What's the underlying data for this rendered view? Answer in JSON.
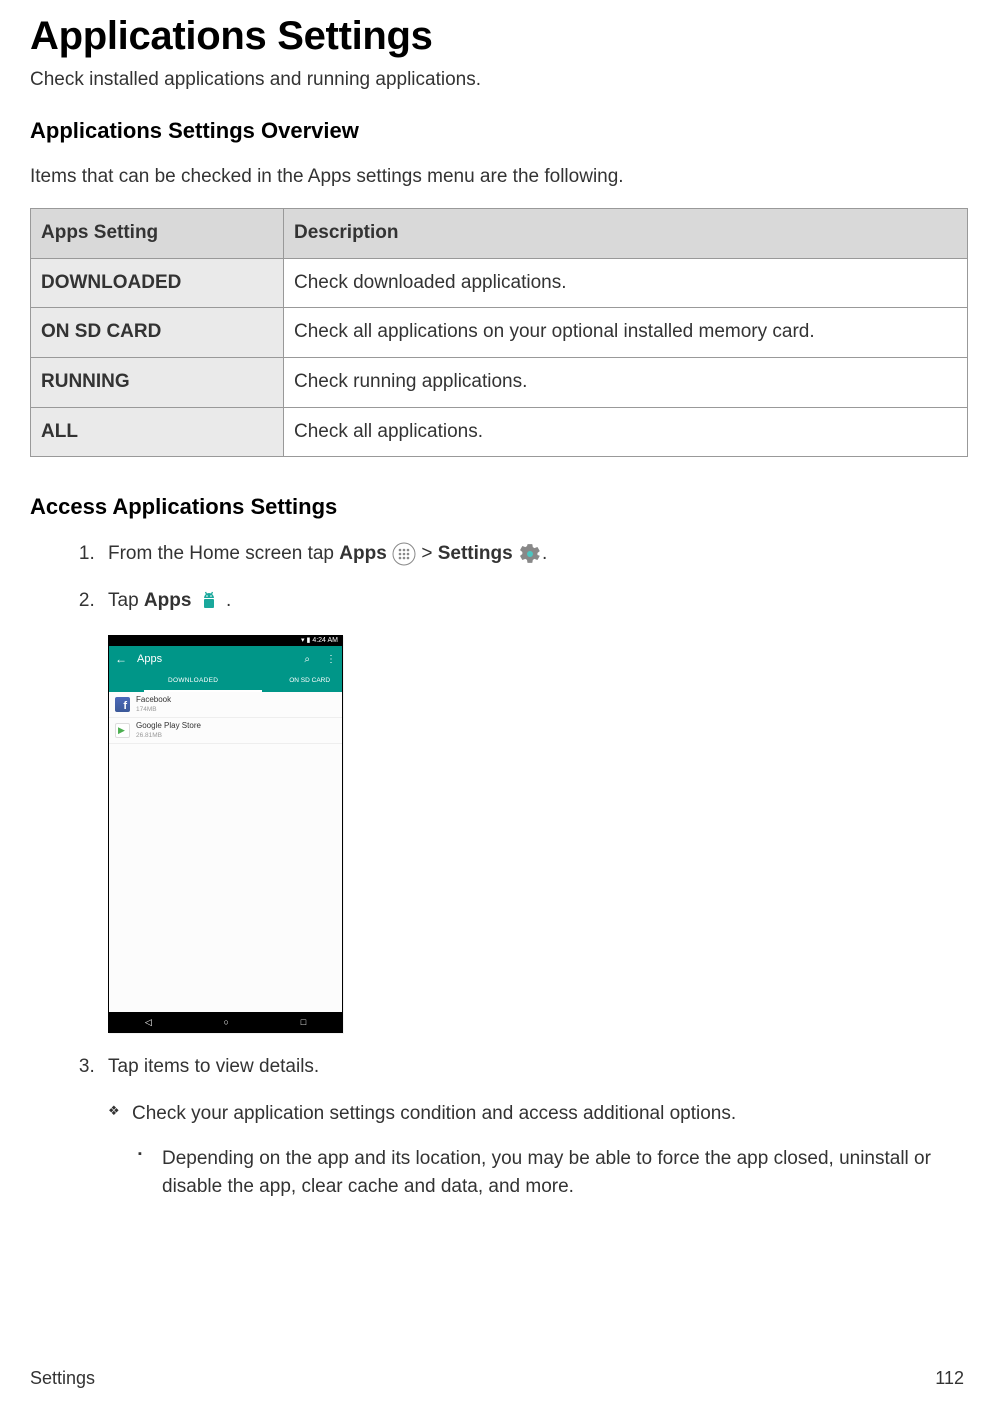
{
  "title": "Applications Settings",
  "subtitle": "Check installed applications and running applications.",
  "section_overview": {
    "heading": "Applications Settings Overview",
    "lead": "Items that can be checked in the Apps settings menu are the following.",
    "table": {
      "header_setting": "Apps Setting",
      "header_desc": "Description",
      "rows": [
        {
          "setting": "DOWNLOADED",
          "desc": "Check downloaded applications."
        },
        {
          "setting": "ON SD CARD",
          "desc": "Check all applications on your optional installed memory card."
        },
        {
          "setting": "RUNNING",
          "desc": "Check running applications."
        },
        {
          "setting": "ALL",
          "desc": "Check all applications."
        }
      ]
    }
  },
  "section_access": {
    "heading": "Access Applications Settings",
    "steps": {
      "s1_pre": "From the Home screen tap ",
      "s1_apps": "Apps",
      "s1_gt": " > ",
      "s1_settings": "Settings",
      "s1_post": " .",
      "s2_pre": "Tap ",
      "s2_apps": "Apps",
      "s2_post": " .",
      "s3": "Tap items to view details."
    },
    "note1": "Check your application settings condition and access additional options.",
    "note2": "Depending on the app and its location, you may be able to force the app closed, uninstall or disable the app, clear cache and data, and more."
  },
  "screenshot": {
    "status_time": "4:24 AM",
    "header_title": "Apps",
    "tab_downloaded": "DOWNLOADED",
    "tab_sd": "ON SD CARD",
    "apps": [
      {
        "name": "Facebook",
        "size": "174MB"
      },
      {
        "name": "Google Play Store",
        "size": "26.81MB"
      }
    ]
  },
  "footer": {
    "left": "Settings",
    "right": "112"
  }
}
